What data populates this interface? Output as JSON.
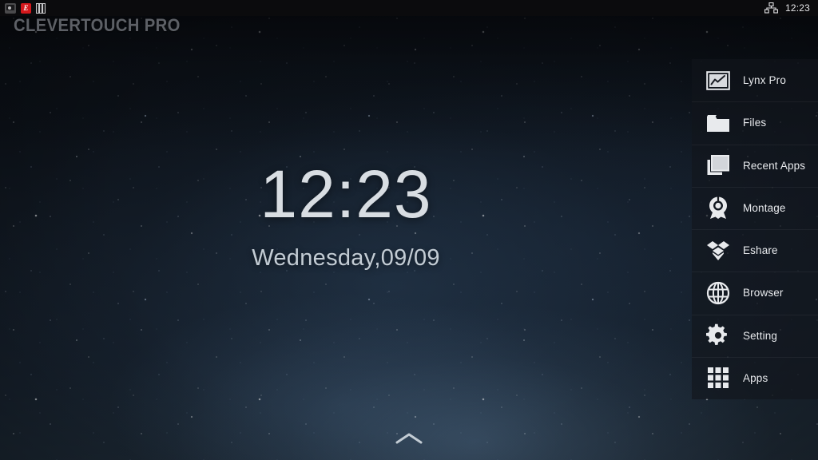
{
  "statusbar": {
    "left_icons": [
      {
        "name": "screenshot-icon",
        "label": "screenshot"
      },
      {
        "name": "eshare-icon",
        "label": "E"
      },
      {
        "name": "bars-icon",
        "label": "bars"
      }
    ],
    "network_icon": "ethernet-network-icon",
    "time": "12:23"
  },
  "brand": {
    "title": "CLEVERTOUCH PRO"
  },
  "clock": {
    "time": "12:23",
    "date": "Wednesday,09/09"
  },
  "bottom": {
    "handle_icon": "chevron-up-icon"
  },
  "sidebar": {
    "items": [
      {
        "label": "Lynx Pro",
        "icon": "chart-frame-icon"
      },
      {
        "label": "Files",
        "icon": "folder-icon"
      },
      {
        "label": "Recent Apps",
        "icon": "stacked-windows-icon"
      },
      {
        "label": "Montage",
        "icon": "badge-medal-icon"
      },
      {
        "label": "Eshare",
        "icon": "diamond-stack-icon"
      },
      {
        "label": "Browser",
        "icon": "globe-icon"
      },
      {
        "label": "Setting",
        "icon": "gear-icon"
      },
      {
        "label": "Apps",
        "icon": "grid-apps-icon"
      }
    ]
  },
  "colors": {
    "accent_red": "#d4181c",
    "icon_white": "#e8eaed",
    "panel": "rgba(18,21,27,0.62)",
    "statusbar_bg": "#0b0b0d",
    "brand_gray": "#5d6066"
  }
}
